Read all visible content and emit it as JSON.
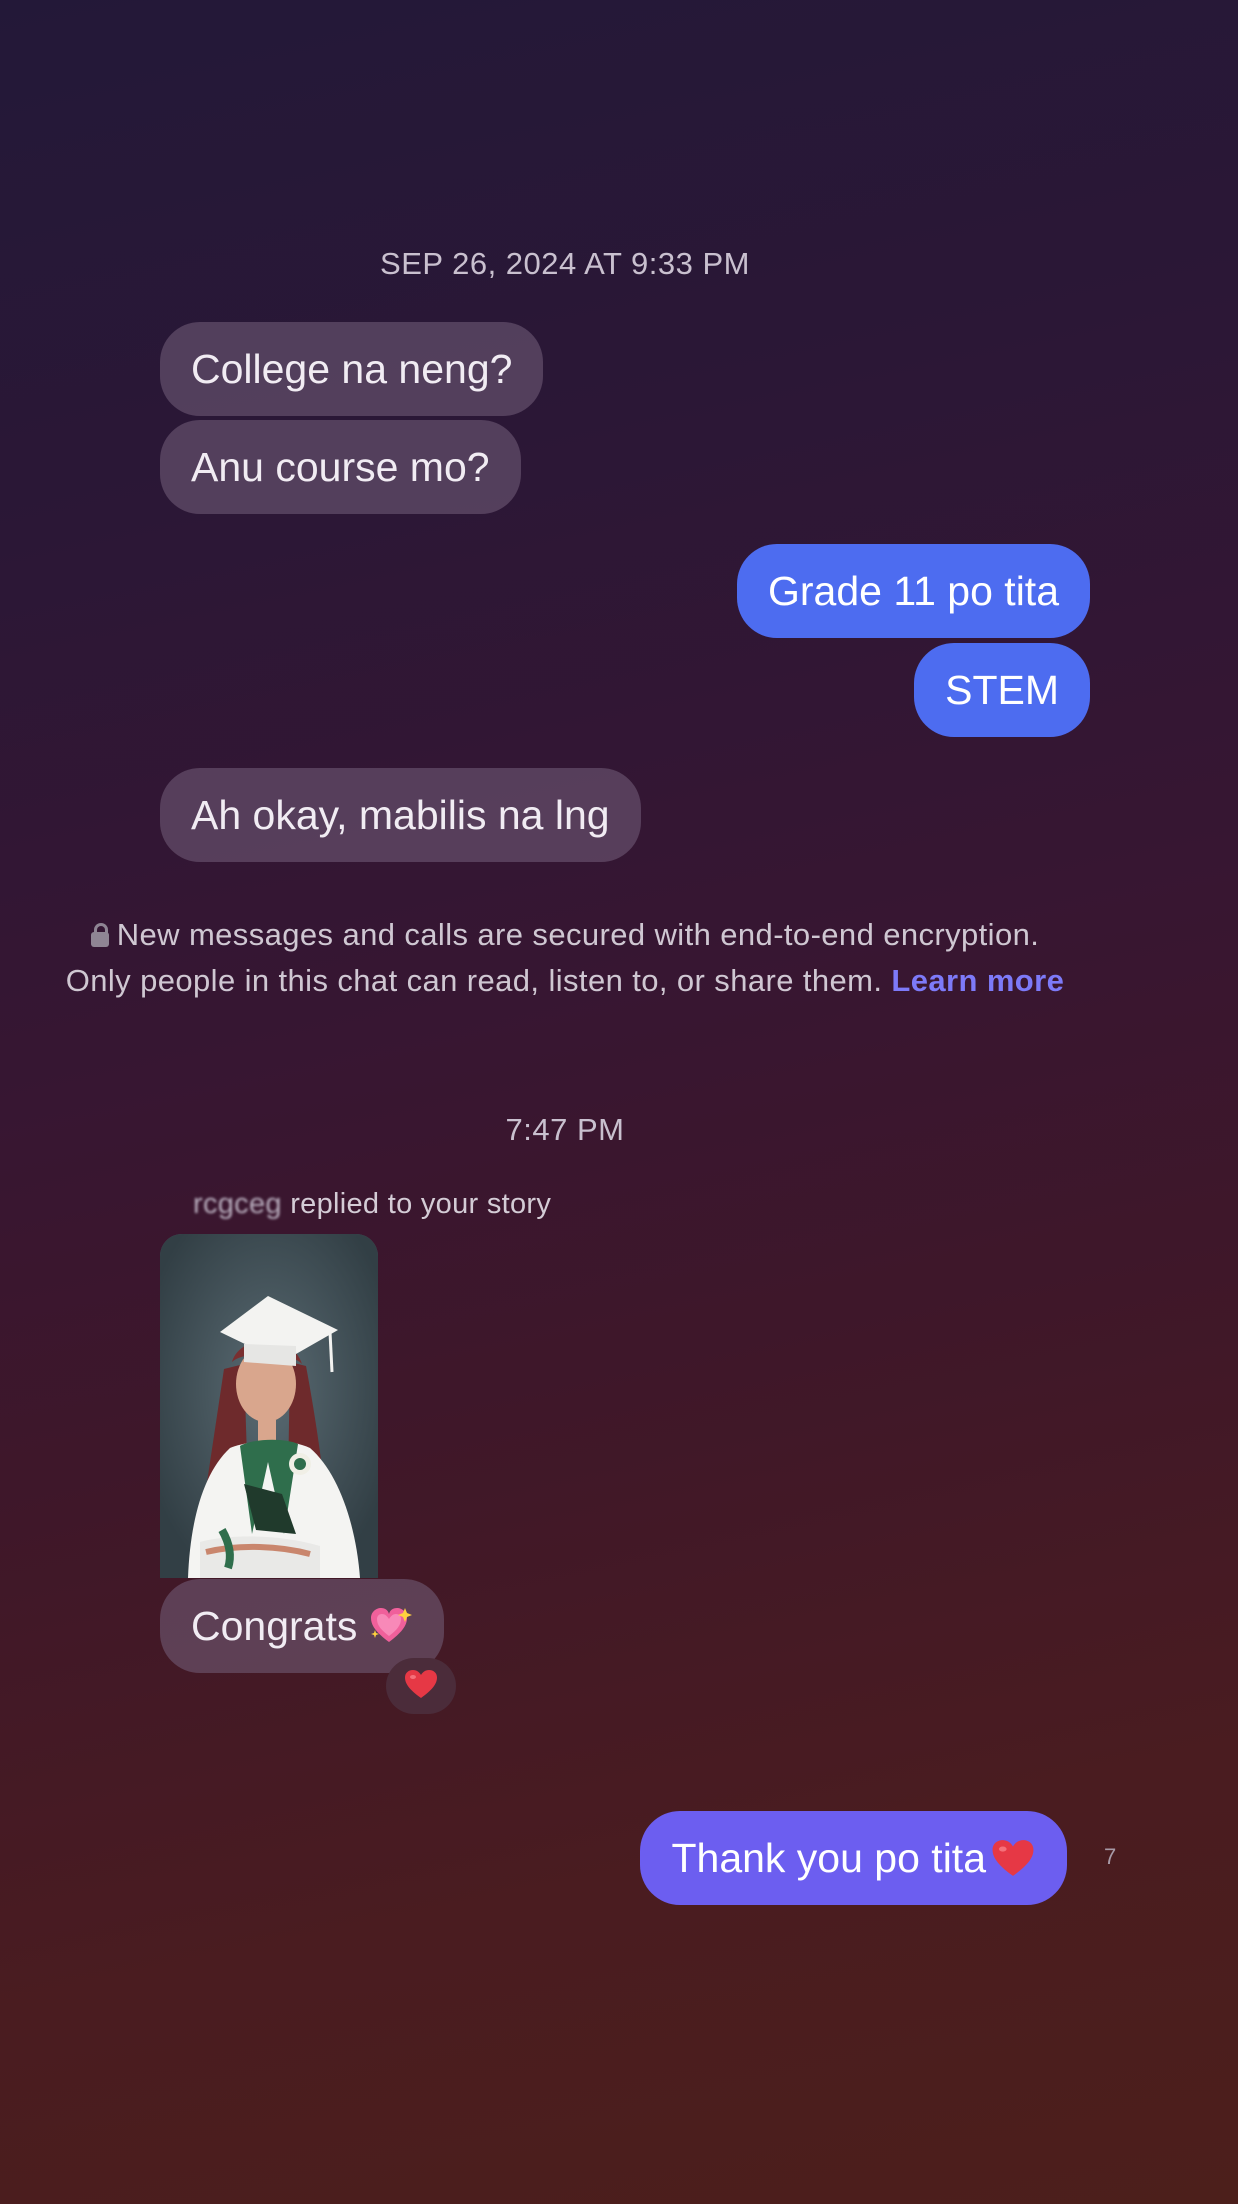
{
  "chat": {
    "timestamp_1": "SEP 26, 2024 AT 9:33 PM",
    "messages_a": [
      {
        "text": "College na neng?"
      },
      {
        "text": "Anu course mo?"
      },
      {
        "text": "Grade 11 po tita"
      },
      {
        "text": "STEM"
      },
      {
        "text": "Ah okay, mabilis na lng"
      }
    ],
    "encryption_notice": {
      "text": "New messages and calls are secured with end-to-end encryption. Only people in this chat can read, listen to, or share them.",
      "link": "Learn more"
    },
    "timestamp_2": "7:47 PM",
    "story_reply": {
      "username": "rcgceg",
      "label": "replied to your story"
    },
    "messages_b": [
      {
        "text": "Congrats",
        "emoji": "sparkling-heart"
      },
      {
        "text": "Thank you po tita",
        "emoji": "red-heart"
      }
    ],
    "reaction": "red-heart",
    "seen_indicator": "7"
  },
  "colors": {
    "incoming_bubble": "#6a5672",
    "outgoing_blue": "#4d6cf0",
    "outgoing_purple": "#6c5ef0",
    "link": "#7d7af8",
    "heart": "#e63845"
  }
}
